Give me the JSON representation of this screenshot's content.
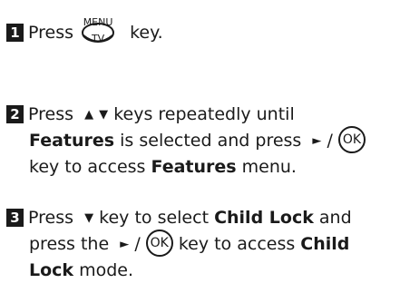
{
  "step1": {
    "number": "1",
    "press": "Press",
    "menu_label": "MENU",
    "tv_label": "TV",
    "suffix": "key."
  },
  "step2": {
    "number": "2",
    "line1_a": "Press",
    "up_arrow": "▲",
    "down_arrow": "▼",
    "line1_b": "keys repeatedly until",
    "features": "Features",
    "line2_b": "is selected and press",
    "right_arrow": "►",
    "slash": "/",
    "ok_label": "OK",
    "line3_a": "key to access",
    "features2": "Features",
    "line3_b": "menu."
  },
  "step3": {
    "number": "3",
    "line1_a": "Press",
    "down_arrow": "▼",
    "line1_b": "key to select",
    "child_lock": "Child Lock",
    "line1_c": "and",
    "line2_a": "press the",
    "right_arrow": "►",
    "slash": "/",
    "ok_label": "OK",
    "line2_b": "key to access",
    "child": "Child",
    "lock": "Lock",
    "line3_b": "mode."
  }
}
